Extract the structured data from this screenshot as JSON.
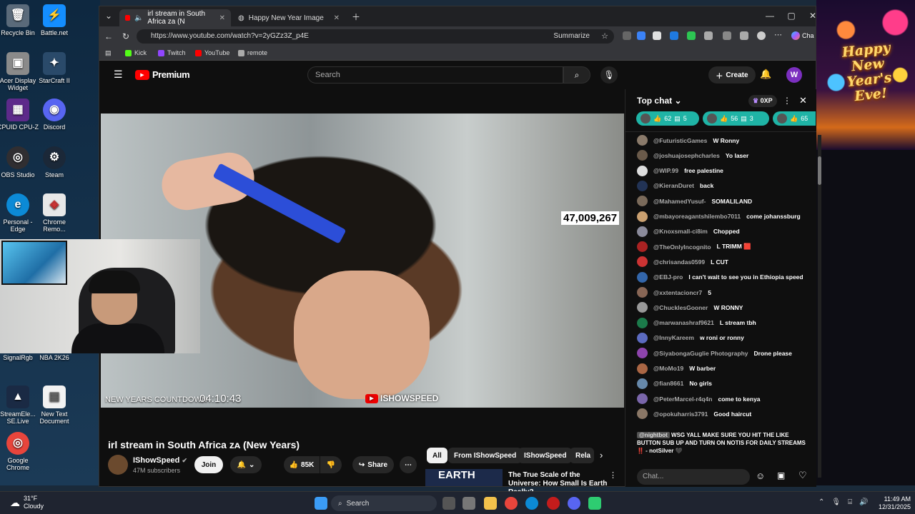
{
  "desktop": {
    "icons": [
      {
        "label": "Recycle Bin",
        "glyph": "🗑",
        "color": "#5a6a7a"
      },
      {
        "label": "Battle.net",
        "glyph": "⚡",
        "color": "#148eff"
      },
      {
        "label": "Acer Display Widget",
        "glyph": "▣",
        "color": "#8a8a8a"
      },
      {
        "label": "StarCraft II",
        "glyph": "✦",
        "color": "#2a4a6a"
      },
      {
        "label": "CPUID CPU-Z",
        "glyph": "▦",
        "color": "#5d2a8a"
      },
      {
        "label": "Discord",
        "glyph": "◉",
        "color": "#5865f2"
      },
      {
        "label": "OBS Studio",
        "glyph": "◎",
        "color": "#302e31"
      },
      {
        "label": "Steam",
        "glyph": "⚙",
        "color": "#1b2838"
      },
      {
        "label": "Personal - Edge",
        "glyph": "e",
        "color": "#0c8ad6"
      },
      {
        "label": "Chrome Remo...",
        "glyph": "◈",
        "color": "#e8e8e8"
      },
      {
        "label": "SignalRgb",
        "glyph": "◆",
        "color": "#7a1f8a"
      },
      {
        "label": "NBA 2K26",
        "glyph": "▶",
        "color": "#b01c1c"
      },
      {
        "label": "StreamEle... SE.Live",
        "glyph": "▲",
        "color": "#1a2a44"
      },
      {
        "label": "New Text Document",
        "glyph": "▤",
        "color": "#f2f2f2"
      },
      {
        "label": "Google Chrome",
        "glyph": "◎",
        "color": "#e8453c"
      }
    ]
  },
  "wallpaper": {
    "greeting": "Happy New Year's Eve!"
  },
  "browser": {
    "tabs": [
      {
        "title": "irl stream in South Africa za (N"
      },
      {
        "title": "Happy New Year Image"
      }
    ],
    "url": "https://www.youtube.com/watch?v=2yGZz3Z_p4E",
    "summarize_label": "Summarize",
    "copilot_label": "Cha",
    "bookmarks": [
      {
        "label": "Kick",
        "color": "#53fc18"
      },
      {
        "label": "Twitch",
        "color": "#9146ff"
      },
      {
        "label": "YouTube",
        "color": "#ff0000"
      },
      {
        "label": "remote",
        "color": "#aaaaaa"
      }
    ]
  },
  "youtube": {
    "logo_label": "Premium",
    "search_placeholder": "Search",
    "create_label": "Create",
    "avatar_letter": "W"
  },
  "video": {
    "view_count": "47,009,267",
    "countdown_label": "NEW YEARS COUNTDOWN",
    "countdown_value": "04:10:43",
    "watermark": "ISHOWSPEED",
    "title": "irl stream in South Africa ᴢᴀ (New Years)",
    "channel_name": "IShowSpeed",
    "subscribers": "47M subscribers",
    "join_label": "Join",
    "likes": "85K",
    "share_label": "Share"
  },
  "recommendations": {
    "chips": [
      {
        "label": "All",
        "selected": true
      },
      {
        "label": "From IShowSpeed",
        "selected": false
      },
      {
        "label": "IShowSpeed",
        "selected": false
      },
      {
        "label": "Rela",
        "selected": false
      }
    ],
    "first": {
      "thumb_text": "EARTH",
      "title": "The True Scale of the Universe: How Small Is Earth Really?"
    }
  },
  "chat": {
    "title": "Top chat",
    "xp_label": "0XP",
    "polls": [
      {
        "likes": "62",
        "comments": "5"
      },
      {
        "likes": "56",
        "comments": "3"
      },
      {
        "likes": "65",
        "comments": ""
      }
    ],
    "messages": [
      {
        "author": "@FuturisticGames",
        "text": "W Ronny",
        "color": "#8a7a6a"
      },
      {
        "author": "@joshuajosephcharles",
        "text": "Yo laser",
        "color": "#6a5a4a"
      },
      {
        "author": "@WIP.99",
        "text": "free palestine",
        "color": "#dddddd"
      },
      {
        "author": "@KieranDuret",
        "text": "back",
        "color": "#223355"
      },
      {
        "author": "@MahamedYusuf-",
        "text": "SOMALILAND",
        "color": "#7a6a5a"
      },
      {
        "author": "@mbayoreagantshilembo7011",
        "text": "come johanssburg",
        "color": "#caa070"
      },
      {
        "author": "@Knoxsmall-ci8im",
        "text": "Chopped",
        "color": "#8a8a9a"
      },
      {
        "author": "@TheOnlyIncognito",
        "text": "L TRIMM 🟥",
        "color": "#aa2222"
      },
      {
        "author": "@chrisandas0599",
        "text": "L CUT",
        "color": "#cc3333"
      },
      {
        "author": "@EBJ-pro",
        "text": "I can't wait to see you in Ethiopia speed",
        "color": "#3366aa"
      },
      {
        "author": "@xxtentacioncr7",
        "text": "5",
        "color": "#886655"
      },
      {
        "author": "@ChucklesGooner",
        "text": "W RONNY",
        "color": "#999999"
      },
      {
        "author": "@marwanashraf9621",
        "text": "L stream tbh",
        "color": "#1b7a4a"
      },
      {
        "author": "@InnyKareem",
        "text": "w roni or ronny",
        "color": "#5c6bc0"
      },
      {
        "author": "@SiyabongaGuglie Photography",
        "text": "Drone please",
        "color": "#8e44ad"
      },
      {
        "author": "@MoMo19",
        "text": "W barber",
        "color": "#aa6644"
      },
      {
        "author": "@fian8661",
        "text": "No girls",
        "color": "#6688aa"
      },
      {
        "author": "@PeterMarcel-r4q4n",
        "text": "come to kenya",
        "color": "#7a66aa"
      },
      {
        "author": "@opokuharris3791",
        "text": "Good haircut",
        "color": "#8a7766"
      }
    ],
    "pinned": {
      "author": "@nightbot",
      "text": "WSG YALL MAKE SURE YOU HIT THE LIKE BUTTON SUB UP AND TURN ON NOTIS FOR DAILY STREAMS ‼️ - notSilver 🖤"
    },
    "input_placeholder": "Chat..."
  },
  "taskbar": {
    "temperature": "31°F",
    "condition": "Cloudy",
    "search_label": "Search",
    "time": "11:49 AM",
    "date": "12/31/2025"
  }
}
